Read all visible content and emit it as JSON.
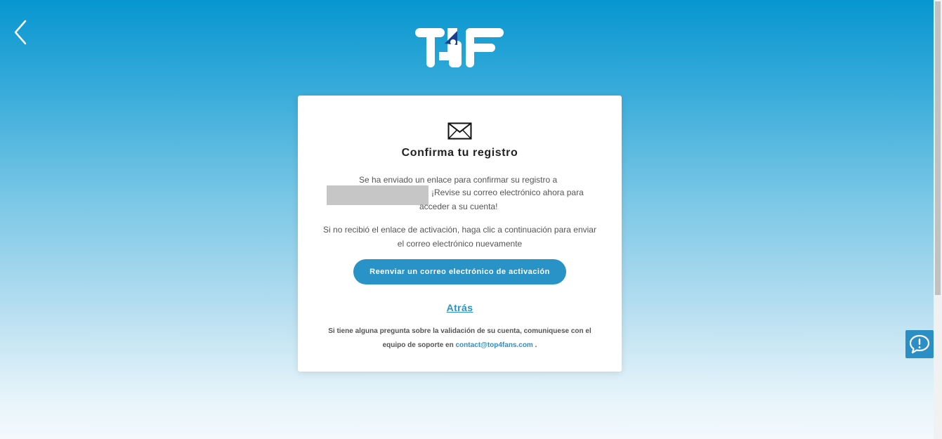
{
  "header": {
    "back_icon": "chevron-left-icon",
    "logo_text": "T4F"
  },
  "card": {
    "icon": "envelope-icon",
    "title": "Confirma tu registro",
    "message_line1": "Se ha enviado un enlace para confirmar su registro a",
    "message_line2": "¡Revise su correo electrónico ahora para",
    "message_line3": "acceder a su cuenta!",
    "resend_prompt": "Si no recibió el enlace de activación, haga clic a continuación para enviar el correo electrónico nuevamente",
    "resend_button_label": "Reenviar un correo electrónico de activación",
    "back_link_label": "Atrás",
    "support_text": "Si tiene alguna pregunta sobre la validación de su cuenta, comuniquese con el equipo de soporte en",
    "support_email": "contact@top4fans.com",
    "support_suffix": "."
  },
  "feedback": {
    "icon": "chat-alert-icon"
  },
  "colors": {
    "accent": "#2993c7",
    "background_top": "#0796d0",
    "background_bottom": "#f3f9fc",
    "logo_accent": "#1a3f8f"
  }
}
